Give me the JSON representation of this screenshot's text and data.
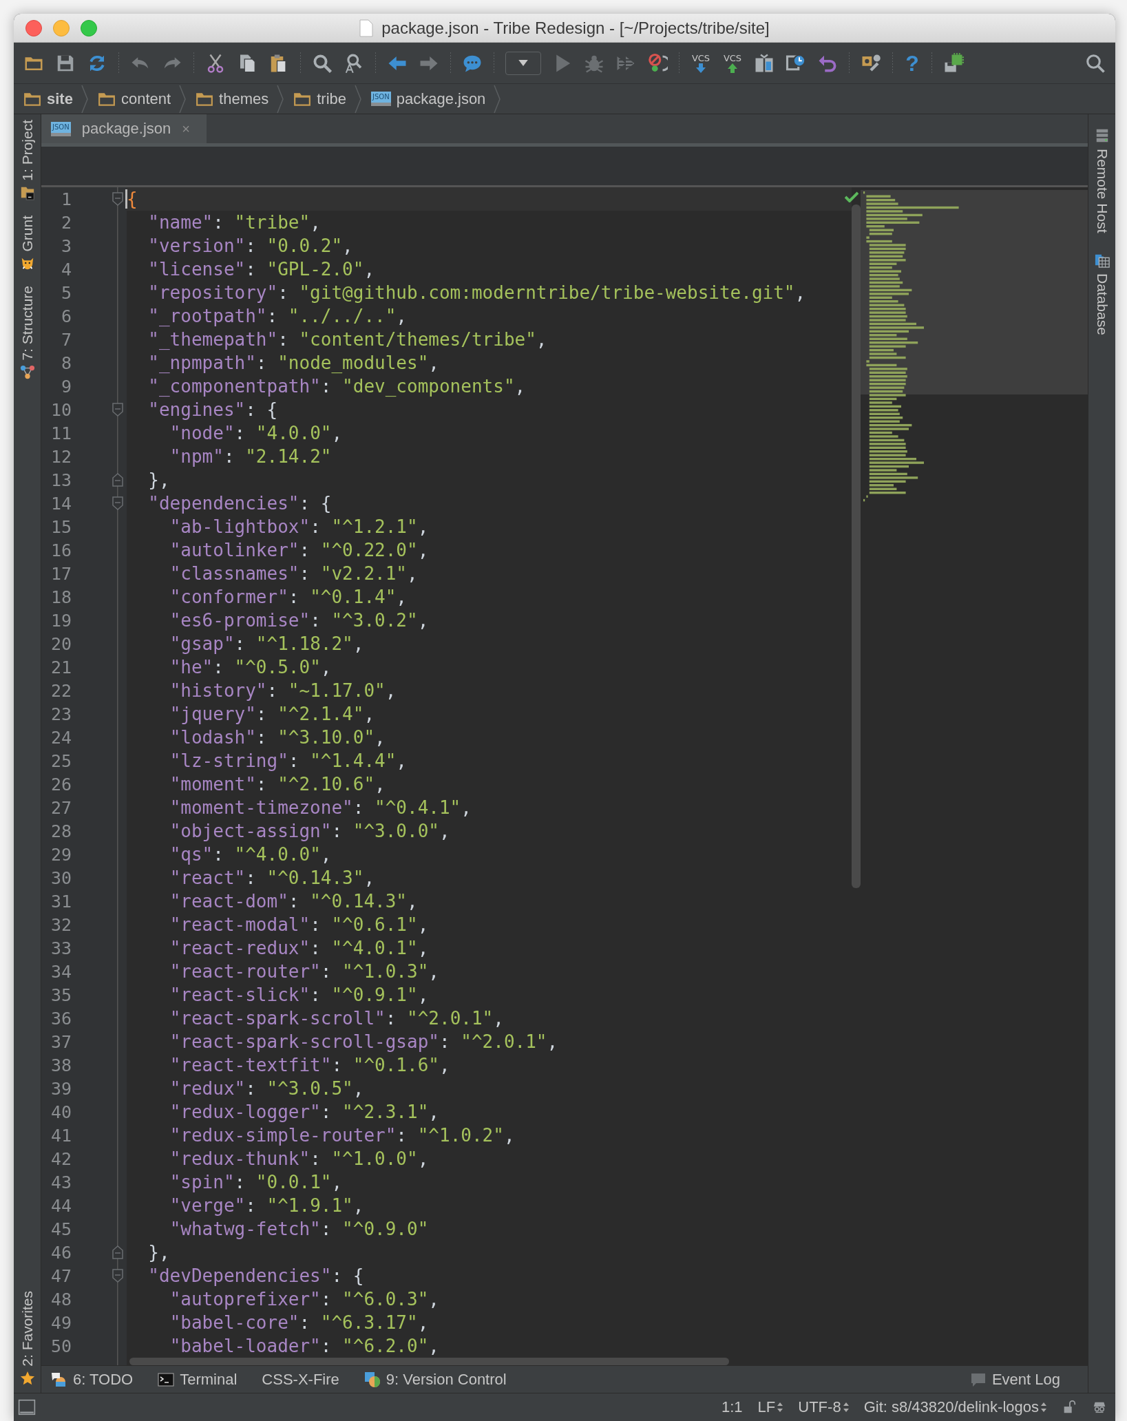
{
  "window": {
    "title": "package.json - Tribe Redesign - [~/Projects/tribe/site]"
  },
  "toolbar": [
    {
      "kind": "open"
    },
    {
      "kind": "save"
    },
    {
      "kind": "sync"
    },
    {
      "kind": "separator"
    },
    {
      "kind": "undo"
    },
    {
      "kind": "redo"
    },
    {
      "kind": "separator"
    },
    {
      "kind": "cut"
    },
    {
      "kind": "copy"
    },
    {
      "kind": "paste"
    },
    {
      "kind": "separator"
    },
    {
      "kind": "find"
    },
    {
      "kind": "replace"
    },
    {
      "kind": "separator"
    },
    {
      "kind": "back"
    },
    {
      "kind": "forward"
    },
    {
      "kind": "separator"
    },
    {
      "kind": "comment"
    },
    {
      "kind": "separator"
    },
    {
      "kind": "config"
    },
    {
      "kind": "run"
    },
    {
      "kind": "debug"
    },
    {
      "kind": "coverage"
    },
    {
      "kind": "stop"
    },
    {
      "kind": "separator"
    },
    {
      "kind": "vcs-update",
      "label": "VCS"
    },
    {
      "kind": "vcs-commit",
      "label": "VCS"
    },
    {
      "kind": "compare"
    },
    {
      "kind": "history"
    },
    {
      "kind": "revert"
    },
    {
      "kind": "separator"
    },
    {
      "kind": "settings"
    },
    {
      "kind": "separator"
    },
    {
      "kind": "help",
      "label": "?"
    },
    {
      "kind": "separator"
    },
    {
      "kind": "sdk"
    }
  ],
  "breadcrumbs": [
    {
      "label": "site",
      "kind": "folder",
      "bold": true
    },
    {
      "label": "content",
      "kind": "folder",
      "bold": false
    },
    {
      "label": "themes",
      "kind": "folder",
      "bold": false
    },
    {
      "label": "tribe",
      "kind": "folder",
      "bold": false
    },
    {
      "label": "package.json",
      "kind": "json",
      "icon_text": "JSON",
      "bold": false
    }
  ],
  "tabs": [
    {
      "label": "package.json",
      "icon_text": "JSON",
      "selected": true,
      "close": "×"
    }
  ],
  "left_strip": [
    {
      "label": "1: Project",
      "kind": "project"
    },
    {
      "label": "Grunt",
      "kind": "grunt"
    },
    {
      "label": "7: Structure",
      "kind": "structure"
    }
  ],
  "left_strip_bottom": [
    {
      "label": "2: Favorites",
      "kind": "favorites"
    }
  ],
  "right_strip": [
    {
      "label": "Remote Host",
      "kind": "remote"
    },
    {
      "label": "Database",
      "kind": "database"
    }
  ],
  "editor": {
    "lines": [
      {
        "number": "1",
        "text": "{",
        "kind": "fold-start",
        "current": true
      },
      {
        "number": "2",
        "text": "  \"name\": \"tribe\",",
        "current": false
      },
      {
        "number": "3",
        "text": "  \"version\": \"0.0.2\",",
        "current": false
      },
      {
        "number": "4",
        "text": "  \"license\": \"GPL-2.0\",",
        "current": false
      },
      {
        "number": "5",
        "text": "  \"repository\": \"git@github.com:moderntribe/tribe-website.git\",",
        "current": false
      },
      {
        "number": "6",
        "text": "  \"_rootpath\": \"../../..\",",
        "current": false
      },
      {
        "number": "7",
        "text": "  \"_themepath\": \"content/themes/tribe\",",
        "current": false
      },
      {
        "number": "8",
        "text": "  \"_npmpath\": \"node_modules\",",
        "current": false
      },
      {
        "number": "9",
        "text": "  \"_componentpath\": \"dev_components\",",
        "current": false
      },
      {
        "number": "10",
        "text": "  \"engines\": {",
        "kind": "fold-start",
        "current": false
      },
      {
        "number": "11",
        "text": "    \"node\": \"4.0.0\",",
        "current": false
      },
      {
        "number": "12",
        "text": "    \"npm\": \"2.14.2\"",
        "current": false
      },
      {
        "number": "13",
        "text": "  },",
        "kind": "fold-end",
        "current": false
      },
      {
        "number": "14",
        "text": "  \"dependencies\": {",
        "kind": "fold-start",
        "current": false
      },
      {
        "number": "15",
        "text": "    \"ab-lightbox\": \"^1.2.1\",",
        "current": false
      },
      {
        "number": "16",
        "text": "    \"autolinker\": \"^0.22.0\",",
        "current": false
      },
      {
        "number": "17",
        "text": "    \"classnames\": \"v2.2.1\",",
        "current": false
      },
      {
        "number": "18",
        "text": "    \"conformer\": \"^0.1.4\",",
        "current": false
      },
      {
        "number": "19",
        "text": "    \"es6-promise\": \"^3.0.2\",",
        "current": false
      },
      {
        "number": "20",
        "text": "    \"gsap\": \"^1.18.2\",",
        "current": false
      },
      {
        "number": "21",
        "text": "    \"he\": \"^0.5.0\",",
        "current": false
      },
      {
        "number": "22",
        "text": "    \"history\": \"~1.17.0\",",
        "current": false
      },
      {
        "number": "23",
        "text": "    \"jquery\": \"^2.1.4\",",
        "current": false
      },
      {
        "number": "24",
        "text": "    \"lodash\": \"^3.10.0\",",
        "current": false
      },
      {
        "number": "25",
        "text": "    \"lz-string\": \"^1.4.4\",",
        "current": false
      },
      {
        "number": "26",
        "text": "    \"moment\": \"^2.10.6\",",
        "current": false
      },
      {
        "number": "27",
        "text": "    \"moment-timezone\": \"^0.4.1\",",
        "current": false
      },
      {
        "number": "28",
        "text": "    \"object-assign\": \"^3.0.0\",",
        "current": false
      },
      {
        "number": "29",
        "text": "    \"qs\": \"^4.0.0\",",
        "current": false
      },
      {
        "number": "30",
        "text": "    \"react\": \"^0.14.3\",",
        "current": false
      },
      {
        "number": "31",
        "text": "    \"react-dom\": \"^0.14.3\",",
        "current": false
      },
      {
        "number": "32",
        "text": "    \"react-modal\": \"^0.6.1\",",
        "current": false
      },
      {
        "number": "33",
        "text": "    \"react-redux\": \"^4.0.1\",",
        "current": false
      },
      {
        "number": "34",
        "text": "    \"react-router\": \"^1.0.3\",",
        "current": false
      },
      {
        "number": "35",
        "text": "    \"react-slick\": \"^0.9.1\",",
        "current": false
      },
      {
        "number": "36",
        "text": "    \"react-spark-scroll\": \"^2.0.1\",",
        "current": false
      },
      {
        "number": "37",
        "text": "    \"react-spark-scroll-gsap\": \"^2.0.1\",",
        "current": false
      },
      {
        "number": "38",
        "text": "    \"react-textfit\": \"^0.1.6\",",
        "current": false
      },
      {
        "number": "39",
        "text": "    \"redux\": \"^3.0.5\",",
        "current": false
      },
      {
        "number": "40",
        "text": "    \"redux-logger\": \"^2.3.1\",",
        "current": false
      },
      {
        "number": "41",
        "text": "    \"redux-simple-router\": \"^1.0.2\",",
        "current": false
      },
      {
        "number": "42",
        "text": "    \"redux-thunk\": \"^1.0.0\",",
        "current": false
      },
      {
        "number": "43",
        "text": "    \"spin\": \"0.0.1\",",
        "current": false
      },
      {
        "number": "44",
        "text": "    \"verge\": \"^1.9.1\",",
        "current": false
      },
      {
        "number": "45",
        "text": "    \"whatwg-fetch\": \"^0.9.0\"",
        "current": false
      },
      {
        "number": "46",
        "text": "  },",
        "kind": "fold-end",
        "current": false
      },
      {
        "number": "47",
        "text": "  \"devDependencies\": {",
        "kind": "fold-start",
        "current": false
      },
      {
        "number": "48",
        "text": "    \"autoprefixer\": \"^6.0.3\",",
        "current": false
      },
      {
        "number": "49",
        "text": "    \"babel-core\": \"^6.3.17\",",
        "current": false
      },
      {
        "number": "50",
        "text": "    \"babel-loader\": \"^6.2.0\",",
        "current": false
      }
    ],
    "inspection_ok": true
  },
  "tool_windows": [
    {
      "label": "6: TODO",
      "kind": "todo"
    },
    {
      "label": "Terminal",
      "kind": "terminal"
    },
    {
      "label": "CSS-X-Fire",
      "kind": "plain"
    },
    {
      "label": "9: Version Control",
      "kind": "vcs"
    }
  ],
  "tool_windows_right": [
    {
      "label": "Event Log",
      "kind": "events"
    }
  ],
  "status_bar": [
    {
      "text": "1:1",
      "dropdown": false
    },
    {
      "text": "LF",
      "dropdown": true
    },
    {
      "text": "UTF-8",
      "dropdown": true
    },
    {
      "text": "Git: s8/43820/delink-logos",
      "dropdown": true
    }
  ]
}
